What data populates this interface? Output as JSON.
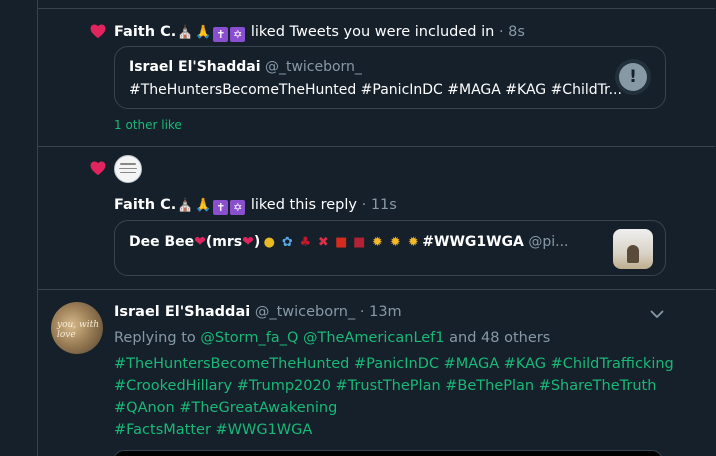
{
  "notif1": {
    "user": "Faith C.",
    "action": "liked Tweets you were included in",
    "time": "· 8s",
    "card": {
      "author": "Israel El'Shaddai",
      "handle": "@_twiceborn_",
      "text": "#TheHuntersBecomeTheHunted #PanicInDC #MAGA #KAG #ChildTr..."
    },
    "other_likes": "1 other like"
  },
  "notif2": {
    "user": "Faith C.",
    "action": "liked this reply",
    "time": "· 11s",
    "card": {
      "author": "Dee Bee",
      "author_suffix": "(mrs",
      "tag": "#WWG1WGA",
      "handle": "@pi..."
    }
  },
  "tweet": {
    "author": "Israel El'Shaddai",
    "handle": "@_twiceborn_",
    "time": "· 13m",
    "replying_prefix": "Replying to",
    "reply_user1": "@Storm_fa_Q",
    "reply_user2": "@TheAmericanLef1",
    "reply_others": "and 48 others",
    "lines": [
      "#TheHuntersBecomeTheHunted #PanicInDC #MAGA #KAG #ChildTrafficking",
      "#CrookedHillary #Trump2020 #TrustThePlan #BeThePlan #ShareTheTruth",
      "#QAnon #TheGreatAwakening",
      "#FactsMatter #WWG1WGA"
    ],
    "avatar_text": "you, with love"
  },
  "icons": {
    "heart": "heart-icon",
    "alert": "exclamation-icon",
    "chevron": "chevron-down-icon"
  },
  "colors": {
    "background": "#15202b",
    "border": "#38444d",
    "muted": "#8899a6",
    "hashtag": "#1ab877",
    "heart": "#e0245e"
  }
}
